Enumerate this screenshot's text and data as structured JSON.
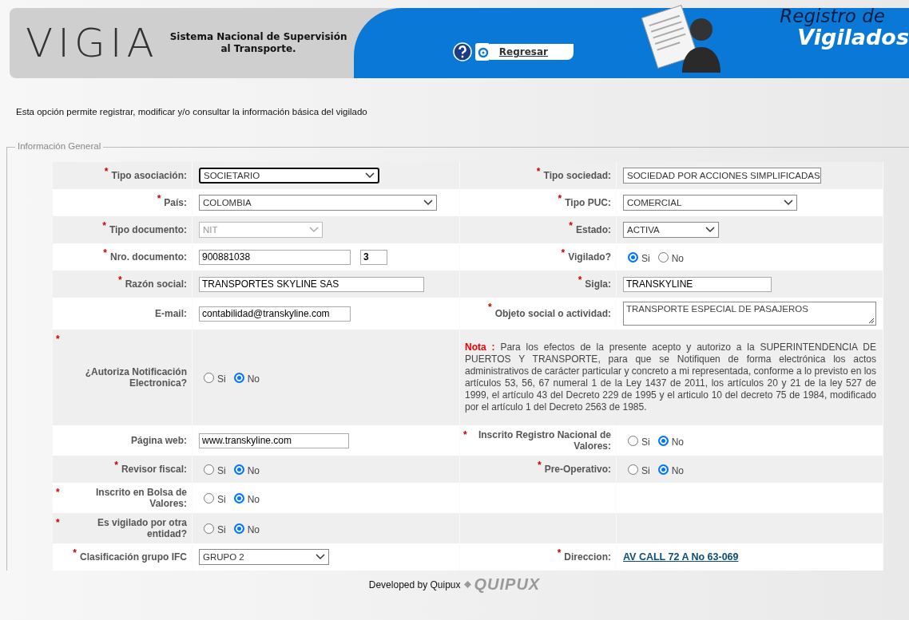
{
  "header": {
    "logo": "VIGIA",
    "system_name": [
      "Sistema Nacional de Supervisión",
      "al Transporte."
    ],
    "back_link": "Regresar",
    "banner_title": [
      "Registro de",
      "Vigilados"
    ]
  },
  "description": "Esta opción permite registrar, modificar y/o consultar la información básica del vigilado",
  "section": {
    "legend": "Información General",
    "rows": [
      {
        "left": {
          "label": "Tipo asociación:",
          "required_mark": "*",
          "kind": "select",
          "value": "SOCIETARIO",
          "disabled": false,
          "focused": true
        },
        "right": {
          "label": "Tipo sociedad:",
          "required_mark": "*",
          "kind": "select",
          "value": "SOCIEDAD POR ACCIONES SIMPLIFICADAS",
          "disabled": false,
          "focused": false
        }
      },
      {
        "left": {
          "label": "País:",
          "required_mark": "*",
          "kind": "select",
          "value": "COLOMBIA",
          "disabled": false,
          "focused": false
        },
        "right": {
          "label": "Tipo PUC:",
          "required_mark": "*",
          "kind": "select",
          "value": "COMERCIAL",
          "disabled": false,
          "focused": false
        }
      },
      {
        "left": {
          "label": "Tipo documento:",
          "required_mark": "*",
          "kind": "select",
          "value": "NIT",
          "disabled": true,
          "focused": false
        },
        "right": {
          "label": "Estado:",
          "required_mark": "*",
          "kind": "select",
          "value": "ACTIVA",
          "disabled": false,
          "focused": false
        }
      },
      {
        "left": {
          "label": "Nro. documento:",
          "required_mark": "*",
          "kind": "document",
          "value": "900881038",
          "check_digit": "3"
        },
        "right": {
          "label": "Vigilado?",
          "required_mark": "*",
          "kind": "radio",
          "options": [
            {
              "label": "Si",
              "selected": true
            },
            {
              "label": "No",
              "selected": false
            }
          ]
        }
      },
      {
        "left": {
          "label": "Razón social:",
          "required_mark": "*",
          "kind": "text",
          "value": "TRANSPORTES SKYLINE SAS"
        },
        "right": {
          "label": "Sigla:",
          "required_mark": "*",
          "kind": "text",
          "value": "TRANSKYLINE"
        }
      },
      {
        "left": {
          "label": "E-mail:",
          "kind": "text",
          "value": "contabilidad@transkyline.com"
        },
        "right": {
          "label": "Objeto social o actividad:",
          "required_mark": "*",
          "kind": "textarea",
          "value": "TRANSPORTE ESPECIAL DE PASAJEROS"
        }
      },
      {
        "left": {
          "label": "¿Autoriza Notificación Electronica?",
          "required_mark": "*",
          "kind": "radio",
          "options": [
            {
              "label": "Si",
              "selected": false
            },
            {
              "label": "No",
              "selected": true
            }
          ]
        },
        "right": {
          "kind": "note",
          "text": "**Nota :** Para los efectos de la presente acepto y autorizo a la SUPERINTENDENCIA DE PUERTOS Y TRANSPORTE, para que se Notifiquen de forma electrónica los actos administrativos de carácter particular y concreto a mi representada, conforme a lo previsto en los artículos 53, 56, 67 numeral 1 de la Ley 1437 de 2011, los artículos 20 y 21 de la ley 527 de 1999, el artículo 43 del Decreto 229 de 1995 y el articulo 10 del decreto 75 de 1984, modificado por el artículo 1 del Decreto 2563 de 1985."
        }
      },
      {
        "left": {
          "label": "Página web:",
          "kind": "text",
          "value": "www.transkyline.com"
        },
        "right": {
          "label": "Inscrito Registro Nacional de Valores:",
          "required_mark": "*",
          "kind": "radio",
          "options": [
            {
              "label": "Si",
              "selected": false
            },
            {
              "label": "No",
              "selected": true
            }
          ]
        }
      },
      {
        "left": {
          "label": "Revisor fiscal:",
          "required_mark": "*",
          "kind": "radio",
          "options": [
            {
              "label": "Si",
              "selected": false
            },
            {
              "label": "No",
              "selected": true
            }
          ]
        },
        "right": {
          "label": "Pre-Operativo:",
          "required_mark": "*",
          "kind": "radio",
          "options": [
            {
              "label": "Si",
              "selected": false
            },
            {
              "label": "No",
              "selected": true
            }
          ]
        }
      },
      {
        "left": {
          "label": "Inscrito en Bolsa de Valores:",
          "required_mark": "*",
          "kind": "radio",
          "options": [
            {
              "label": "Si",
              "selected": false
            },
            {
              "label": "No",
              "selected": true
            }
          ]
        }
      },
      {
        "left": {
          "label": "Es vigilado por otra entidad?",
          "required_mark": "*",
          "kind": "radio",
          "options": [
            {
              "label": "Si",
              "selected": false
            },
            {
              "label": "No",
              "selected": true
            }
          ]
        }
      },
      {
        "left": {
          "label": "Clasificación grupo IFC",
          "required_mark": "*",
          "kind": "select",
          "value": "GRUPO 2",
          "disabled": false,
          "focused": false
        },
        "right": {
          "label": "Direccion:",
          "required_mark": "*",
          "kind": "link",
          "value": "AV CALL 72 A No 63-069"
        }
      }
    ]
  },
  "footer": {
    "text": "Developed by Quipux",
    "logo": "QUIPUX"
  }
}
